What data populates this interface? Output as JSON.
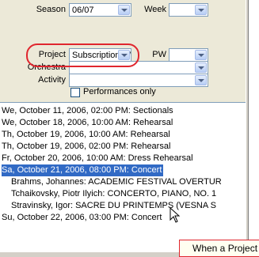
{
  "filters": {
    "season": {
      "label": "Season",
      "value": "06/07"
    },
    "week": {
      "label": "Week",
      "value": ""
    },
    "project": {
      "label": "Project",
      "value": "Subscription We"
    },
    "pw": {
      "label": "PW",
      "value": ""
    },
    "orchestra": {
      "label": "Orchestra",
      "value": ""
    },
    "activity": {
      "label": "Activity",
      "value": ""
    },
    "performances_only": {
      "label": "Performances only",
      "checked": false
    }
  },
  "events": [
    {
      "text": "We, October  11, 2006, 02:00 PM: Sectionals",
      "indent": false,
      "selected": false
    },
    {
      "text": "We, October  18, 2006, 10:00 AM: Rehearsal",
      "indent": false,
      "selected": false
    },
    {
      "text": "Th, October  19, 2006, 10:00 AM: Rehearsal",
      "indent": false,
      "selected": false
    },
    {
      "text": "Th, October  19, 2006, 02:00 PM: Rehearsal",
      "indent": false,
      "selected": false
    },
    {
      "text": "Fr, October  20, 2006, 10:00 AM: Dress Rehearsal",
      "indent": false,
      "selected": false
    },
    {
      "text": "Sa, October  21, 2006, 08:00 PM: Concert",
      "indent": false,
      "selected": true
    },
    {
      "text": "Brahms, Johannes: ACADEMIC FESTIVAL OVERTUR",
      "indent": true,
      "selected": false
    },
    {
      "text": "Tchaikovsky, Piotr Ilyich: CONCERTO, PIANO, NO. 1",
      "indent": true,
      "selected": false
    },
    {
      "text": "Stravinsky, Igor: SACRE DU PRINTEMPS (VESNA S",
      "indent": true,
      "selected": false
    },
    {
      "text": "Su, October  22, 2006, 03:00 PM: Concert",
      "indent": false,
      "selected": false
    }
  ],
  "tooltip": {
    "text": "When a Project"
  },
  "colors": {
    "selection": "#316ac5",
    "annotation": "#e0262e"
  }
}
